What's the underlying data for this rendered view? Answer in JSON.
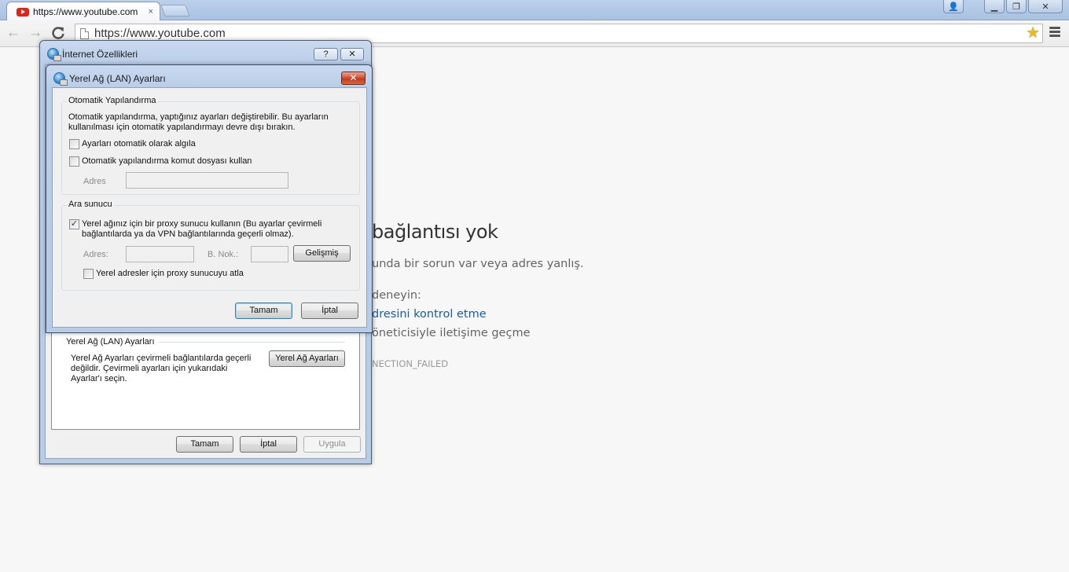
{
  "browser": {
    "tab_title": "https://www.youtube.com",
    "tab_close": "×",
    "url": "https://www.youtube.com",
    "back": "←",
    "forward": "→",
    "reload": "C",
    "star": "★",
    "win_user": "👤",
    "win_min": "▁",
    "win_restore": "❐",
    "win_close": "✕"
  },
  "error_page": {
    "title": "bağlantısı yok",
    "description": "unda bir sorun var veya adres yanlış.",
    "try_label": "deneyin:",
    "link": "dresini kontrol etme",
    "admin": "öneticisiyle iletişime geçme",
    "code": "NECTION_FAILED"
  },
  "internet_options": {
    "title": "İnternet Özellikleri",
    "help_btn": "?",
    "close_btn": "✕",
    "lan_section": {
      "legend": "Yerel Ağ (LAN) Ayarları",
      "description": "Yerel Ağ Ayarları çevirmeli bağlantılarda geçerli değildir. Çevirmeli ayarları için yukarıdaki Ayarlar'ı seçin.",
      "button": "Yerel Ağ Ayarları"
    },
    "ok": "Tamam",
    "cancel": "İptal",
    "apply": "Uygula"
  },
  "lan_dialog": {
    "title": "Yerel Ağ (LAN) Ayarları",
    "close_btn": "✕",
    "auto_config": {
      "legend": "Otomatik Yapılandırma",
      "description": "Otomatik yapılandırma, yaptığınız ayarları değiştirebilir. Bu ayarların kullanılması için otomatik yapılandırmayı devre dışı bırakın.",
      "detect_label": "Ayarları otomatik olarak algıla",
      "detect_checked": false,
      "script_label": "Otomatik yapılandırma komut dosyası kullan",
      "script_checked": false,
      "address_label": "Adres",
      "address_value": ""
    },
    "proxy": {
      "legend": "Ara sunucu",
      "use_proxy_label": "Yerel ağınız için bir proxy sunucu kullanın (Bu ayarlar çevirmeli bağlantılarda ya da VPN bağlantılarında geçerli olmaz).",
      "use_proxy_checked": true,
      "check_mark": "✓",
      "address_label": "Adres:",
      "address_value": "",
      "port_label": "B. Nok.:",
      "port_value": "",
      "advanced_btn": "Gelişmiş",
      "bypass_label": "Yerel adresler için proxy sunucuyu atla",
      "bypass_checked": false
    },
    "ok": "Tamam",
    "cancel": "İptal"
  }
}
